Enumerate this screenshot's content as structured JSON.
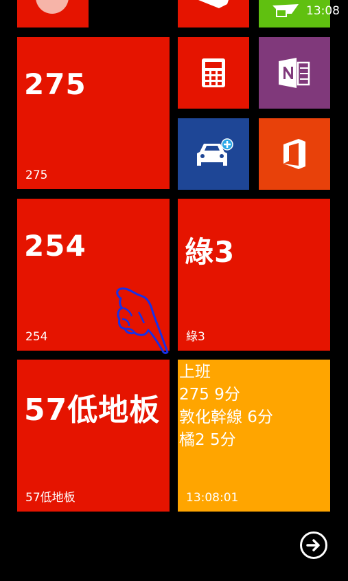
{
  "status": {
    "time": "13:08"
  },
  "tiles": {
    "t275": {
      "big": "275",
      "small": "275"
    },
    "t254": {
      "big": "254",
      "small": "254"
    },
    "tgreen3": {
      "big": "綠3",
      "small": "綠3"
    },
    "t57": {
      "big": "57低地板",
      "small": "57低地板"
    },
    "live": {
      "lines": [
        "上班",
        "275 9分",
        "敦化幹線 6分",
        "橘2 5分"
      ],
      "time": "13:08:01"
    }
  },
  "icons": {
    "calculator": "calculator-icon",
    "onenote": "onenote-icon",
    "car": "car-add-icon",
    "office": "office-icon",
    "arrow": "arrow-right-circle-icon",
    "pointer": "hand-pointer-icon"
  },
  "colors": {
    "red": "#E51400",
    "green": "#60C010",
    "purple": "#80397B",
    "blue": "#1E4696",
    "orange_red": "#E8410A",
    "amber": "#FFA500"
  }
}
